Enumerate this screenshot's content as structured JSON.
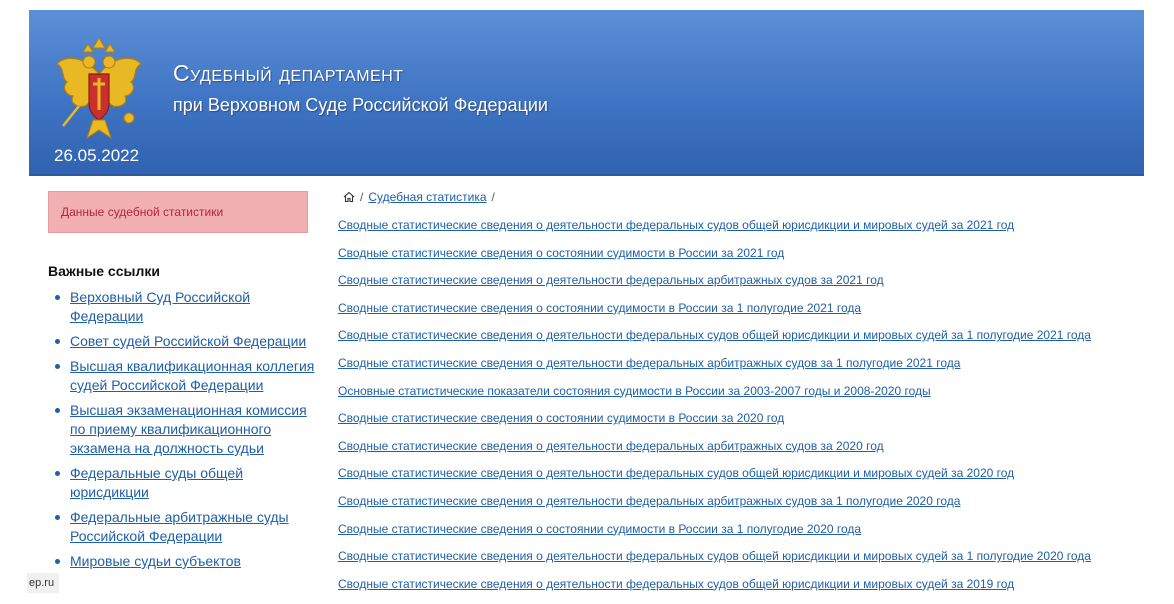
{
  "header": {
    "title": "Судебный департамент",
    "subtitle": "при Верховном Суде Российской Федерации",
    "date": "26.05.2022",
    "colors": {
      "top": "#5b8fd6",
      "bottom": "#2f62b0",
      "text": "#ffffff"
    }
  },
  "sidebar": {
    "stat_button": "Данные судебной статистики",
    "links_heading": "Важные ссылки",
    "links": [
      "Верховный Суд Российской Федерации",
      "Совет судей Российской Федерации",
      "Высшая квалификационная коллегия судей Российской Федерации",
      "Высшая экзаменационная комиссия по приему квалификационного экзамена на должность судьи",
      "Федеральные суды общей юрисдикции",
      "Федеральные арбитражные суды Российской Федерации",
      "Мировые судьи субъектов"
    ],
    "watermark": "ep.ru"
  },
  "breadcrumb": {
    "home_icon": "home-icon",
    "item": "Судебная статистика",
    "separator": "/"
  },
  "documents": [
    "Сводные статистические сведения о деятельности федеральных судов общей юрисдикции и мировых судей за 2021 год",
    "Сводные статистические сведения о состоянии судимости в России за 2021 год",
    "Сводные статистические сведения о деятельности федеральных арбитражных судов за 2021 год",
    "Сводные статистические сведения о состоянии судимости в России за 1 полугодие 2021 года",
    "Сводные статистические сведения о деятельности федеральных судов общей юрисдикции и мировых судей за 1 полугодие 2021 года",
    "Сводные статистические сведения о деятельности федеральных арбитражных судов за 1 полугодие 2021 года",
    "Основные статистические показатели состояния судимости в России за 2003-2007 годы и 2008-2020 годы",
    "Сводные статистические сведения о состоянии судимости в России за 2020 год",
    "Сводные статистические сведения о деятельности федеральных арбитражных судов за 2020 год",
    "Сводные статистические сведения о деятельности федеральных судов общей юрисдикции и мировых судей за 2020 год",
    "Сводные статистические сведения о деятельности федеральных арбитражных судов за 1 полугодие 2020 года",
    "Сводные статистические сведения о состоянии судимости в России за 1 полугодие 2020 года",
    "Сводные статистические сведения о деятельности федеральных судов общей юрисдикции и мировых судей за 1 полугодие 2020 года",
    "Сводные статистические сведения о деятельности федеральных судов общей юрисдикции и мировых судей за 2019 год"
  ],
  "link_color": "#1f5fa8"
}
